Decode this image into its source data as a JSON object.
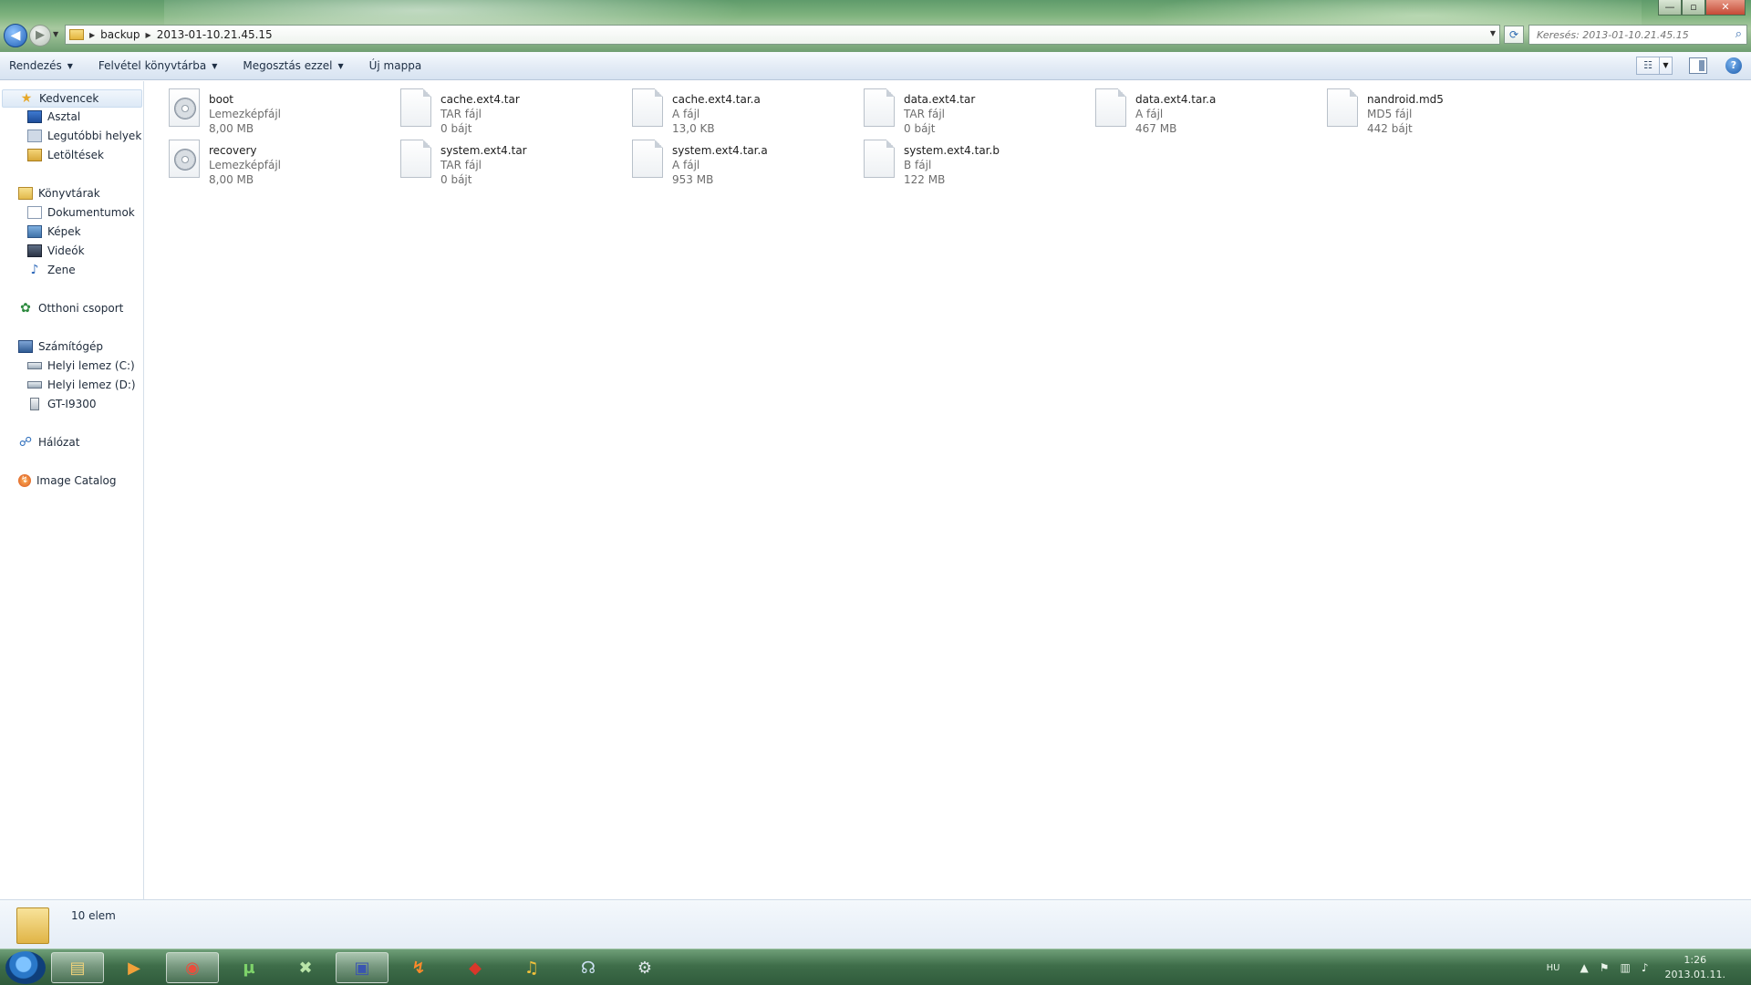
{
  "window": {
    "controls": {
      "minimize": "—",
      "maximize": "▫",
      "close": "✕"
    }
  },
  "nav_buttons": {
    "back": "◀",
    "forward": "▶",
    "history": "▼"
  },
  "address": {
    "crumbs": [
      "backup",
      "2013-01-10.21.45.15"
    ],
    "separator": "▶",
    "dropdown": "▼",
    "refresh": "⟳"
  },
  "search": {
    "placeholder": "Keresés: 2013-01-10.21.45.15",
    "icon": "⌕"
  },
  "toolbar": {
    "organize": "Rendezés",
    "include_library": "Felvétel könyvtárba",
    "share_with": "Megosztás ezzel",
    "new_folder": "Új mappa",
    "arrow": "▼",
    "view_icon": "☷",
    "view_dd": "▼",
    "help": "?"
  },
  "sidebar": {
    "favorites": {
      "label": "Kedvencek",
      "icon": "★",
      "items": [
        {
          "label": "Asztal",
          "icon": "desktop-icon"
        },
        {
          "label": "Legutóbbi helyek",
          "icon": "recent-places-icon"
        },
        {
          "label": "Letöltések",
          "icon": "downloads-icon"
        }
      ]
    },
    "libraries": {
      "label": "Könyvtárak",
      "items": [
        {
          "label": "Dokumentumok",
          "icon": "documents-icon"
        },
        {
          "label": "Képek",
          "icon": "pictures-icon"
        },
        {
          "label": "Videók",
          "icon": "videos-icon"
        },
        {
          "label": "Zene",
          "icon": "♪"
        }
      ]
    },
    "homegroup": {
      "label": "Otthoni csoport",
      "icon": "✿"
    },
    "computer": {
      "label": "Számítógép",
      "items": [
        {
          "label": "Helyi lemez (C:)",
          "icon": "hard-drive-icon"
        },
        {
          "label": "Helyi lemez (D:)",
          "icon": "hard-drive-icon"
        },
        {
          "label": "GT-I9300",
          "icon": "phone-icon"
        }
      ]
    },
    "network": {
      "label": "Hálózat",
      "icon": "☍"
    },
    "image_catalog": {
      "label": "Image Catalog",
      "icon": "↯"
    }
  },
  "files": [
    {
      "name": "boot",
      "type": "Lemezképfájl",
      "size": "8,00 MB",
      "icon": "disc-image-icon"
    },
    {
      "name": "cache.ext4.tar",
      "type": "TAR fájl",
      "size": "0 bájt",
      "icon": "file-icon"
    },
    {
      "name": "cache.ext4.tar.a",
      "type": "A fájl",
      "size": "13,0 KB",
      "icon": "file-icon"
    },
    {
      "name": "data.ext4.tar",
      "type": "TAR fájl",
      "size": "0 bájt",
      "icon": "file-icon"
    },
    {
      "name": "data.ext4.tar.a",
      "type": "A fájl",
      "size": "467 MB",
      "icon": "file-icon"
    },
    {
      "name": "nandroid.md5",
      "type": "MD5 fájl",
      "size": "442 bájt",
      "icon": "file-icon"
    },
    {
      "name": "recovery",
      "type": "Lemezképfájl",
      "size": "8,00 MB",
      "icon": "disc-image-icon"
    },
    {
      "name": "system.ext4.tar",
      "type": "TAR fájl",
      "size": "0 bájt",
      "icon": "file-icon"
    },
    {
      "name": "system.ext4.tar.a",
      "type": "A fájl",
      "size": "953 MB",
      "icon": "file-icon"
    },
    {
      "name": "system.ext4.tar.b",
      "type": "B fájl",
      "size": "122 MB",
      "icon": "file-icon"
    }
  ],
  "status": {
    "count": "10 elem"
  },
  "taskbar": {
    "apps": [
      {
        "name": "explorer",
        "glyph": "▤"
      },
      {
        "name": "media-player",
        "glyph": "▶"
      },
      {
        "name": "chrome",
        "glyph": "◉"
      },
      {
        "name": "utorrent",
        "glyph": "µ"
      },
      {
        "name": "xbox-app",
        "glyph": "✖"
      },
      {
        "name": "save-app",
        "glyph": "▣"
      },
      {
        "name": "flash-app",
        "glyph": "↯"
      },
      {
        "name": "git-app",
        "glyph": "◆"
      },
      {
        "name": "headphones-app",
        "glyph": "♫"
      },
      {
        "name": "teamspeak",
        "glyph": "☊"
      },
      {
        "name": "steam",
        "glyph": "⚙"
      }
    ],
    "tray": {
      "lang": "HU",
      "up_arrow": "▲",
      "flag": "⚑",
      "network": "▥",
      "volume": "♪",
      "time": "1:26",
      "date": "2013.01.11."
    }
  },
  "colors": {
    "accent": "#2a66b8",
    "taskbar": "#3f6e4a",
    "titlebar": "#7fb37e",
    "toolbar": "#e4ecf6"
  }
}
